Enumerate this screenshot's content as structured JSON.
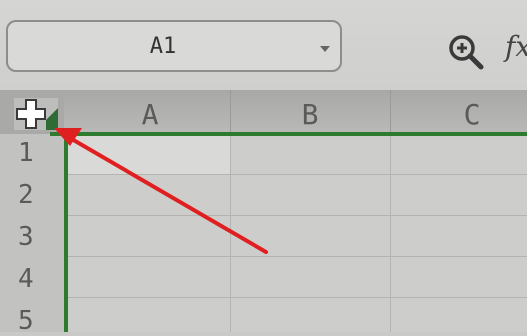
{
  "name_box": {
    "value": "A1"
  },
  "formula_bar": {
    "fx_label": "fx"
  },
  "columns": [
    {
      "label": "A"
    },
    {
      "label": "B"
    },
    {
      "label": "C"
    }
  ],
  "rows": [
    {
      "label": "1"
    },
    {
      "label": "2"
    },
    {
      "label": "3"
    },
    {
      "label": "4"
    },
    {
      "label": "5"
    }
  ],
  "selection": {
    "border_color": "#2e7a2e"
  },
  "annotation": {
    "arrow_color": "#e02020"
  }
}
